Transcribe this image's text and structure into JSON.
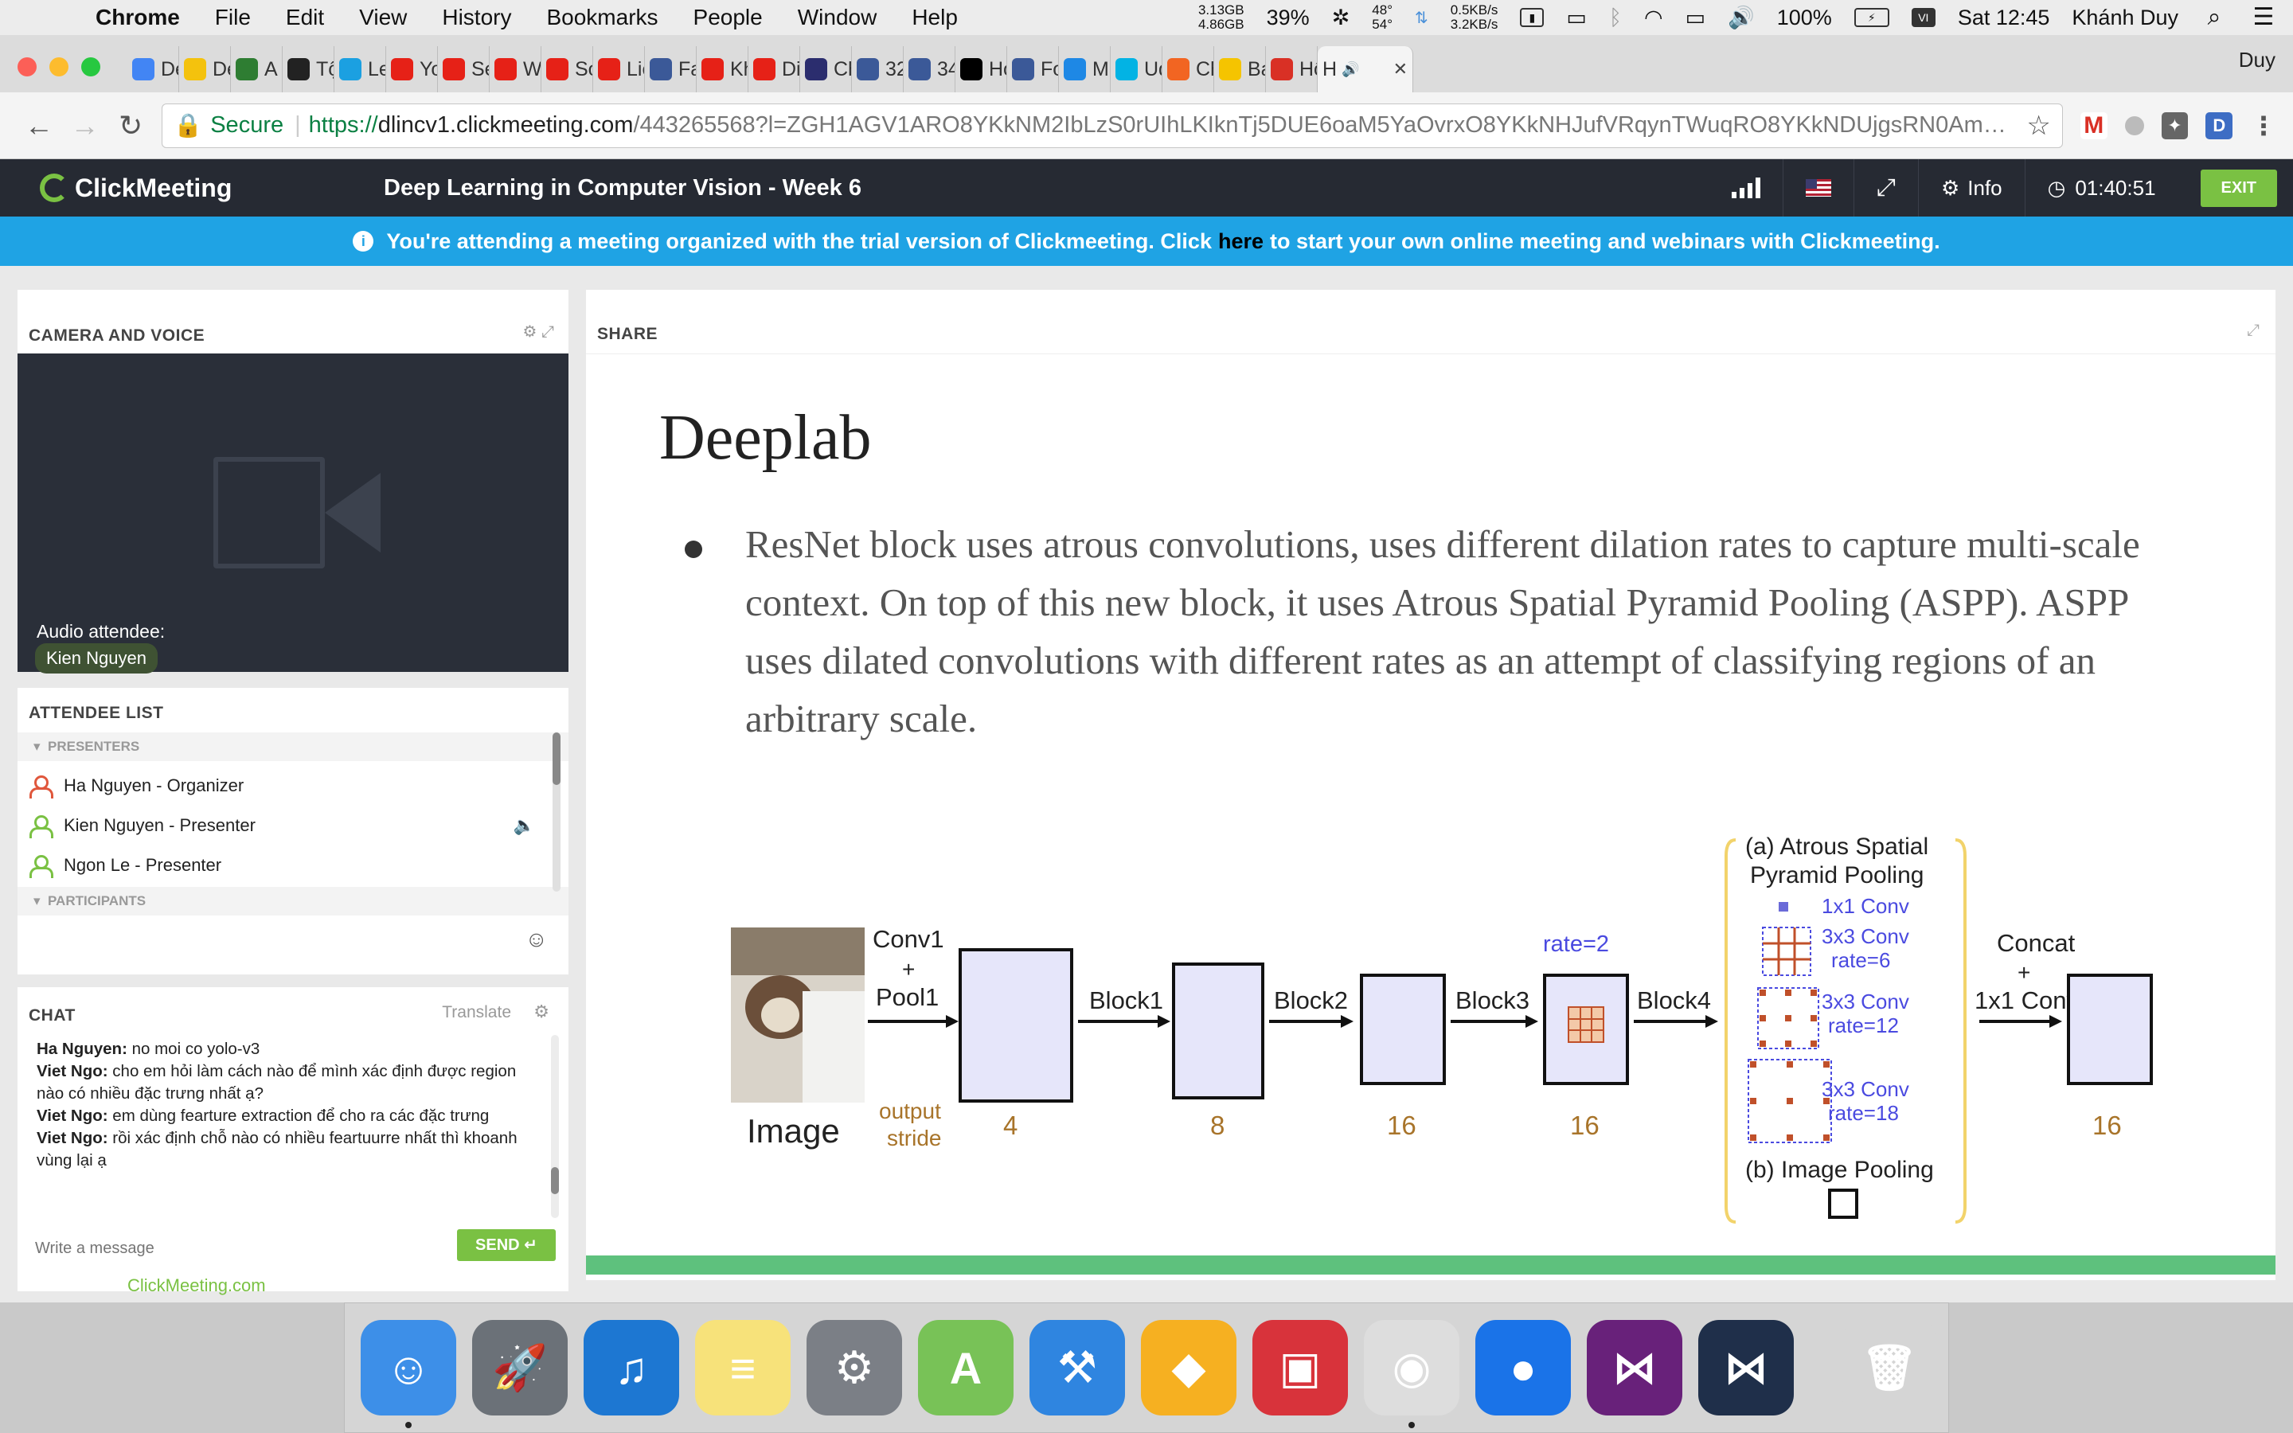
{
  "menubar": {
    "app": "Chrome",
    "items": [
      "File",
      "Edit",
      "View",
      "History",
      "Bookmarks",
      "People",
      "Window",
      "Help"
    ],
    "mem": [
      "3.13GB",
      "4.86GB"
    ],
    "cpu": "39%",
    "temps": [
      "48°",
      "54°"
    ],
    "net": [
      "0.5KB/s",
      "3.2KB/s"
    ],
    "battery": "100%",
    "clock": "Sat 12:45",
    "user": "Khánh Duy"
  },
  "tabs": [
    {
      "label": "De",
      "color": "#4285f4"
    },
    {
      "label": "De",
      "color": "#f4c20d"
    },
    {
      "label": "A c",
      "color": "#2e7d32"
    },
    {
      "label": "Tộ",
      "color": "#222222"
    },
    {
      "label": "Lei",
      "color": "#1ba0e1"
    },
    {
      "label": "Yo",
      "color": "#e62117"
    },
    {
      "label": "Se",
      "color": "#e62117"
    },
    {
      "label": "We",
      "color": "#e62117"
    },
    {
      "label": "So",
      "color": "#e62117"
    },
    {
      "label": "Liê",
      "color": "#e62117"
    },
    {
      "label": "Fac",
      "color": "#3b5998"
    },
    {
      "label": "Kh",
      "color": "#e62117"
    },
    {
      "label": "Dir",
      "color": "#e62117"
    },
    {
      "label": "Ch",
      "color": "#2b2d6e"
    },
    {
      "label": "32",
      "color": "#3b5998"
    },
    {
      "label": "34",
      "color": "#3b5998"
    },
    {
      "label": "Ho",
      "color": "#000000"
    },
    {
      "label": "Fo",
      "color": "#3b5998"
    },
    {
      "label": "Ma",
      "color": "#1e88e5"
    },
    {
      "label": "Ud",
      "color": "#02b3e4"
    },
    {
      "label": "Ch",
      "color": "#f26522"
    },
    {
      "label": "Bai",
      "color": "#f5c400"
    },
    {
      "label": "Hộ",
      "color": "#d93025"
    }
  ],
  "active_tab": {
    "label": "H"
  },
  "profile": "Duy",
  "address": {
    "secure": "Secure",
    "scheme": "https://",
    "host": "dlincv1.clickmeeting.com",
    "path": "/443265568?l=ZGH1AGV1ARO8YKkNM2IbLzS0rUIhLKIknTj5DUE6oaM5YaOvrxO8YKkNHJufVRqynTWuqRO8YKkNDUjgsRN0AmNmZ..."
  },
  "app": {
    "brand": "ClickMeeting",
    "title": "Deep Learning in Computer Vision - Week 6",
    "info": "Info",
    "timer": "01:40:51",
    "exit": "EXIT"
  },
  "banner": {
    "before": "You're attending a meeting organized with the trial version of Clickmeeting. Click",
    "link": "here",
    "after": "to start your own online meeting and webinars with Clickmeeting."
  },
  "camera": {
    "title": "CAMERA AND VOICE",
    "audio_label": "Audio attendee:",
    "audio_name": "Kien Nguyen"
  },
  "attendees": {
    "title": "ATTENDEE LIST",
    "presenters_hdr": "PRESENTERS",
    "participants_hdr": "PARTICIPANTS",
    "people": [
      {
        "name": "Ha Nguyen  - Organizer",
        "color": "#e0573c"
      },
      {
        "name": "Kien Nguyen  - Presenter",
        "color": "#7ac143"
      },
      {
        "name": "Ngon Le  - Presenter",
        "color": "#7ac143"
      }
    ]
  },
  "chat": {
    "title": "CHAT",
    "translate": "Translate",
    "messages": [
      {
        "author": "Ha Nguyen:",
        "text": " no moi co yolo-v3"
      },
      {
        "author": "Viet Ngo:",
        "text": " cho em hỏi làm cách nào để mình xác định được region nào có nhiều đặc trưng nhất ạ?"
      },
      {
        "author": "Viet Ngo:",
        "text": " em dùng fearture extraction để cho ra các đặc trưng"
      },
      {
        "author": "Viet Ngo:",
        "text": " rồi xác định chỗ nào có nhiều feartuurre nhất thì khoanh vùng lại ạ"
      }
    ],
    "placeholder": "Write a message",
    "send": "SEND",
    "powered": "ClickMeeting.com"
  },
  "share": {
    "title": "SHARE",
    "slide_title": "Deeplab",
    "bullet": "ResNet block uses atrous convolutions, uses different dilation rates to capture multi-scale context. On top of this new block, it uses Atrous Spatial Pyramid Pooling (ASPP). ASPP uses dilated convolutions with different rates as an attempt of classifying regions of an arbitrary scale."
  },
  "diagram": {
    "image_label": "Image",
    "conv1": "Conv1",
    "plus": "+",
    "pool1": "Pool1",
    "output_stride": [
      "output",
      "stride"
    ],
    "blocks": [
      "Block1",
      "Block2",
      "Block3",
      "Block4"
    ],
    "strides": [
      "4",
      "8",
      "16",
      "16",
      "16"
    ],
    "rate2": "rate=2",
    "aspp_title": [
      "(a) Atrous Spatial",
      "Pyramid Pooling"
    ],
    "aspp_items": [
      "1x1 Conv",
      "3x3 Conv",
      "rate=6",
      "3x3 Conv",
      "rate=12",
      "3x3 Conv",
      "rate=18"
    ],
    "image_pooling": "(b) Image Pooling",
    "concat": [
      "Concat",
      "+",
      "1x1 Conv"
    ]
  },
  "dock": [
    {
      "name": "Finder",
      "color": "#3d8fe8",
      "glyph": "☺",
      "running": true
    },
    {
      "name": "Launchpad",
      "color": "#6b7178",
      "glyph": "🚀",
      "running": false
    },
    {
      "name": "iTunes",
      "color": "#1d77d2",
      "glyph": "♫",
      "running": false
    },
    {
      "name": "Notes",
      "color": "#f7e27a",
      "glyph": "≡",
      "running": false
    },
    {
      "name": "System Preferences",
      "color": "#7b7f86",
      "glyph": "⚙",
      "running": false
    },
    {
      "name": "Android Studio",
      "color": "#78c257",
      "glyph": "A",
      "running": false
    },
    {
      "name": "Xcode",
      "color": "#2f85e0",
      "glyph": "⚒",
      "running": false
    },
    {
      "name": "Sketch",
      "color": "#f6b021",
      "glyph": "◆",
      "running": false
    },
    {
      "name": "Parallels",
      "color": "#d8333b",
      "glyph": "▣",
      "running": false
    },
    {
      "name": "Chrome",
      "color": "#dddddd",
      "glyph": "◉",
      "running": true
    },
    {
      "name": "Proxyman",
      "color": "#1a73e8",
      "glyph": "●",
      "running": false
    },
    {
      "name": "Visual Studio",
      "color": "#68217a",
      "glyph": "⋈",
      "running": false
    },
    {
      "name": "VS Code",
      "color": "#1f2f4a",
      "glyph": "⋈",
      "running": false
    },
    {
      "name": "Trash",
      "color": "#d5d5d5",
      "glyph": "🗑",
      "running": false
    }
  ]
}
